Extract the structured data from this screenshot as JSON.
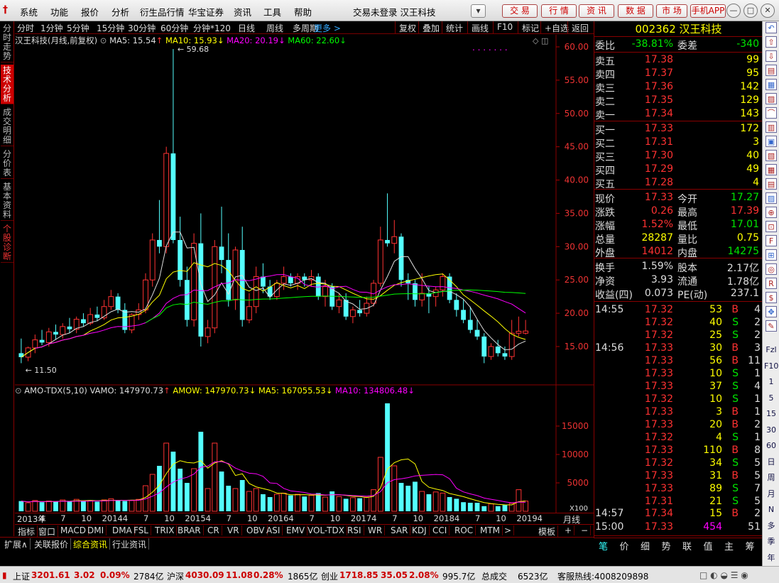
{
  "menubar": {
    "logo": "†",
    "items": [
      "系统",
      "功能",
      "报价",
      "分析",
      "衍生品行情",
      "华宝证券",
      "资讯",
      "工具",
      "帮助"
    ],
    "title": "交易未登录  汉王科技",
    "buttons": [
      "交 易",
      "行 情",
      "资 讯",
      "数 据",
      "市 场",
      "手机APP"
    ]
  },
  "lefttabs": [
    {
      "label": "分时走势"
    },
    {
      "label": "技术分析",
      "active": true
    },
    {
      "label": "成交明细"
    },
    {
      "label": "分价表"
    },
    {
      "label": "基本资料"
    },
    {
      "label": "个股诊断",
      "red": true
    }
  ],
  "toolbar": {
    "periods": [
      "分时",
      "1分钟",
      "5分钟",
      "15分钟",
      "30分钟",
      "60分钟",
      "分钟*120",
      "日线",
      "周线",
      "多周期"
    ],
    "more": "更多 >",
    "right": [
      "复权",
      "叠加",
      "统计",
      "画线",
      "F10",
      "标记",
      "+自选",
      "返回"
    ]
  },
  "chartinfo": {
    "title": "汉王科技(月线,前复权)",
    "ma5": "MA5: 15.54",
    "ma10": "MA10: 15.93",
    "ma20": "MA20: 20.19",
    "ma60": "MA60: 22.60",
    "high_label": "59.68",
    "low_label": "11.50"
  },
  "volinfo": {
    "name": "AMO-TDX(5,10)",
    "vamo": "VAMO: 147970.73",
    "amow": "AMOW: 147970.73",
    "ma5": "MA5: 167055.53",
    "ma10": "MA10: 134806.48",
    "unit": "X100"
  },
  "price_axis": [
    "60.00",
    "55.00",
    "50.00",
    "45.00",
    "40.00",
    "35.00",
    "30.00",
    "25.00",
    "20.00",
    "15.00"
  ],
  "vol_axis": [
    "15000",
    "10000",
    "5000"
  ],
  "xaxis": {
    "labels": [
      "2013年",
      "4",
      "7",
      "10",
      "2014",
      "4",
      "7",
      "10",
      "2015",
      "4",
      "7",
      "10",
      "2016",
      "4",
      "7",
      "10",
      "2017",
      "4",
      "7",
      "10",
      "2018",
      "4",
      "7",
      "10",
      "2019",
      "4"
    ],
    "period": "月线"
  },
  "bottomtabs": [
    "指标",
    "窗口",
    "MACD",
    "DMI",
    "DMA",
    "FSL",
    "TRIX",
    "BRAR",
    "CR",
    "VR",
    "OBV",
    "ASI",
    "EMV",
    "VOL-TDX",
    "RSI",
    "WR",
    "SAR",
    "KDJ",
    "CCI",
    "ROC",
    "MTM",
    ">"
  ],
  "bottom_right": [
    "模板",
    "+",
    "−"
  ],
  "subbar": [
    "扩展∧",
    "关联报价",
    "综合资讯",
    "行业资讯"
  ],
  "quote": {
    "code": "002362 汉王科技",
    "weibi_label": "委比",
    "weibi": "-38.81%",
    "weicha_label": "委差",
    "weicha": "-340",
    "asks": [
      {
        "label": "卖五",
        "price": "17.38",
        "vol": "99"
      },
      {
        "label": "卖四",
        "price": "17.37",
        "vol": "95"
      },
      {
        "label": "卖三",
        "price": "17.36",
        "vol": "142"
      },
      {
        "label": "卖二",
        "price": "17.35",
        "vol": "129"
      },
      {
        "label": "卖一",
        "price": "17.34",
        "vol": "143"
      }
    ],
    "bids": [
      {
        "label": "买一",
        "price": "17.33",
        "vol": "172"
      },
      {
        "label": "买二",
        "price": "17.31",
        "vol": "3"
      },
      {
        "label": "买三",
        "price": "17.30",
        "vol": "40"
      },
      {
        "label": "买四",
        "price": "17.29",
        "vol": "49"
      },
      {
        "label": "买五",
        "price": "17.28",
        "vol": "4"
      }
    ],
    "stats": [
      {
        "l1": "现价",
        "v1": "17.33",
        "c1": "up",
        "l2": "今开",
        "v2": "17.27",
        "c2": "dn"
      },
      {
        "l1": "涨跌",
        "v1": "0.26",
        "c1": "up",
        "l2": "最高",
        "v2": "17.39",
        "c2": "up"
      },
      {
        "l1": "涨幅",
        "v1": "1.52%",
        "c1": "up",
        "l2": "最低",
        "v2": "17.01",
        "c2": "dn"
      },
      {
        "l1": "总量",
        "v1": "28287",
        "c1": "yl",
        "l2": "量比",
        "v2": "0.75",
        "c2": "yl"
      },
      {
        "l1": "外盘",
        "v1": "14012",
        "c1": "up",
        "l2": "内盘",
        "v2": "14275",
        "c2": "dn"
      }
    ],
    "stats2": [
      {
        "l1": "换手",
        "v1": "1.59%",
        "l2": "股本",
        "v2": "2.17亿"
      },
      {
        "l1": "净资",
        "v1": "3.93",
        "l2": "流通",
        "v2": "1.78亿"
      },
      {
        "l1": "收益(四)",
        "v1": "0.073",
        "l2": "PE(动)",
        "v2": "237.1"
      }
    ],
    "ticks": [
      {
        "t": "14:55",
        "p": "17.32",
        "v": "53",
        "s": "B",
        "n": "4"
      },
      {
        "t": "",
        "p": "17.32",
        "v": "40",
        "s": "S",
        "n": "2"
      },
      {
        "t": "",
        "p": "17.32",
        "v": "25",
        "s": "S",
        "n": "2"
      },
      {
        "t": "14:56",
        "p": "17.33",
        "v": "30",
        "s": "B",
        "n": "3"
      },
      {
        "t": "",
        "p": "17.33",
        "v": "56",
        "s": "B",
        "n": "11"
      },
      {
        "t": "",
        "p": "17.33",
        "v": "10",
        "s": "S",
        "n": "1"
      },
      {
        "t": "",
        "p": "17.33",
        "v": "37",
        "s": "S",
        "n": "4"
      },
      {
        "t": "",
        "p": "17.32",
        "v": "10",
        "s": "S",
        "n": "1"
      },
      {
        "t": "",
        "p": "17.33",
        "v": "3",
        "s": "B",
        "n": "1"
      },
      {
        "t": "",
        "p": "17.33",
        "v": "20",
        "s": "B",
        "n": "2"
      },
      {
        "t": "",
        "p": "17.32",
        "v": "4",
        "s": "S",
        "n": "1"
      },
      {
        "t": "",
        "p": "17.33",
        "v": "110",
        "s": "B",
        "n": "8"
      },
      {
        "t": "",
        "p": "17.32",
        "v": "34",
        "s": "S",
        "n": "5"
      },
      {
        "t": "",
        "p": "17.33",
        "v": "31",
        "s": "B",
        "n": "5"
      },
      {
        "t": "",
        "p": "17.33",
        "v": "89",
        "s": "S",
        "n": "7"
      },
      {
        "t": "",
        "p": "17.31",
        "v": "21",
        "s": "S",
        "n": "5"
      },
      {
        "t": "14:57",
        "p": "17.34",
        "v": "15",
        "s": "B",
        "n": "2"
      },
      {
        "t": "15:00",
        "p": "17.33",
        "v": "454",
        "s": "",
        "n": "51"
      }
    ],
    "bottom_tabs": [
      "笔",
      "价",
      "细",
      "势",
      "联",
      "值",
      "主",
      "筹"
    ]
  },
  "rtool": [
    "Fzl",
    "F10",
    "1",
    "5",
    "15",
    "30",
    "60",
    "日",
    "周",
    "月",
    "N",
    "多",
    "季",
    "年"
  ],
  "statusbar": {
    "sh_label": "上证",
    "sh": "3201.61",
    "sh_chg": "3.02",
    "sh_pct": "0.09%",
    "sh_amt": "2784亿",
    "hs_label": "沪深",
    "hs": "4030.09",
    "hs_chg": "11.08",
    "hs_pct": "0.28%",
    "hs_amt": "1865亿",
    "cy_label": "创业",
    "cy": "1718.85",
    "cy_chg": "35.05",
    "cy_pct": "2.08%",
    "cy_amt": "995.7亿",
    "total_label": "总成交",
    "total": "6523亿",
    "hotline": "客服热线:4008209898"
  },
  "chart_data": {
    "type": "candlestick",
    "title": "汉王科技(月线,前复权)",
    "ylim": [
      10,
      62
    ],
    "candles": [
      [
        14.0,
        16.2,
        12.5,
        13.4
      ],
      [
        13.4,
        15.0,
        12.8,
        14.8
      ],
      [
        14.8,
        16.8,
        14.0,
        16.0
      ],
      [
        16.0,
        17.5,
        15.2,
        15.6
      ],
      [
        15.6,
        17.8,
        15.0,
        17.2
      ],
      [
        17.2,
        18.3,
        16.0,
        16.8
      ],
      [
        16.8,
        18.5,
        16.2,
        18.0
      ],
      [
        18.0,
        19.3,
        17.0,
        17.6
      ],
      [
        17.6,
        19.5,
        17.0,
        19.1
      ],
      [
        19.1,
        20.0,
        18.0,
        18.5
      ],
      [
        18.5,
        20.8,
        18.2,
        19.8
      ],
      [
        19.8,
        21.0,
        18.8,
        19.3
      ],
      [
        19.3,
        22.0,
        19.0,
        21.0
      ],
      [
        21.0,
        23.5,
        20.5,
        22.5
      ],
      [
        22.5,
        23.0,
        20.0,
        20.5
      ],
      [
        20.5,
        21.5,
        17.0,
        17.5
      ],
      [
        17.5,
        20.0,
        17.0,
        19.8
      ],
      [
        19.8,
        21.5,
        19.0,
        20.5
      ],
      [
        20.5,
        26.0,
        20.0,
        25.0
      ],
      [
        25.0,
        32.0,
        24.0,
        31.0
      ],
      [
        31.0,
        37.0,
        29.0,
        30.0
      ],
      [
        30.0,
        45.0,
        29.0,
        44.0
      ],
      [
        44.0,
        59.68,
        30.5,
        31.0
      ],
      [
        31.0,
        34.5,
        24.0,
        25.0
      ],
      [
        25.0,
        27.0,
        18.0,
        19.0
      ],
      [
        19.0,
        32.0,
        18.0,
        30.5
      ],
      [
        30.5,
        35.0,
        15.0,
        16.5
      ],
      [
        16.5,
        19.0,
        15.5,
        17.8
      ],
      [
        17.8,
        31.0,
        17.0,
        30.0
      ],
      [
        30.0,
        36.0,
        26.0,
        28.0
      ],
      [
        28.0,
        32.0,
        21.0,
        22.0
      ],
      [
        22.0,
        30.0,
        20.5,
        29.5
      ],
      [
        29.5,
        33.0,
        18.0,
        19.0
      ],
      [
        19.0,
        23.0,
        18.5,
        21.0
      ],
      [
        21.0,
        27.0,
        20.0,
        25.5
      ],
      [
        25.5,
        27.5,
        23.0,
        24.0
      ],
      [
        24.0,
        25.0,
        22.0,
        22.5
      ],
      [
        22.5,
        25.0,
        22.0,
        24.5
      ],
      [
        24.5,
        27.0,
        23.5,
        25.5
      ],
      [
        25.5,
        26.0,
        24.0,
        24.5
      ],
      [
        24.5,
        26.0,
        23.5,
        25.5
      ],
      [
        25.5,
        26.0,
        24.0,
        25.0
      ],
      [
        25.0,
        26.5,
        24.0,
        25.5
      ],
      [
        25.5,
        26.0,
        22.0,
        22.5
      ],
      [
        22.5,
        25.0,
        21.0,
        24.0
      ],
      [
        24.0,
        24.5,
        20.5,
        21.0
      ],
      [
        21.0,
        23.0,
        20.0,
        22.0
      ],
      [
        22.0,
        23.0,
        19.0,
        19.5
      ],
      [
        19.5,
        21.0,
        18.5,
        20.5
      ],
      [
        20.5,
        22.0,
        19.5,
        20.0
      ],
      [
        20.0,
        22.5,
        19.5,
        21.5
      ],
      [
        21.5,
        25.0,
        21.0,
        24.5
      ],
      [
        24.5,
        33.0,
        24.0,
        31.0
      ],
      [
        31.0,
        38.0,
        30.0,
        30.5
      ],
      [
        30.5,
        34.0,
        29.0,
        31.5
      ],
      [
        31.5,
        32.0,
        24.0,
        25.0
      ],
      [
        25.0,
        26.0,
        22.0,
        24.5
      ],
      [
        24.5,
        25.0,
        21.0,
        22.0
      ],
      [
        22.0,
        26.0,
        21.0,
        23.0
      ],
      [
        23.0,
        24.0,
        20.0,
        22.5
      ],
      [
        22.5,
        24.0,
        21.0,
        23.5
      ],
      [
        23.5,
        26.0,
        22.5,
        25.5
      ],
      [
        25.5,
        26.0,
        21.5,
        22.0
      ],
      [
        22.0,
        23.0,
        19.5,
        20.5
      ],
      [
        20.5,
        22.0,
        18.5,
        19.0
      ],
      [
        19.0,
        21.0,
        17.0,
        17.5
      ],
      [
        17.5,
        19.0,
        16.0,
        16.5
      ],
      [
        16.5,
        17.0,
        12.5,
        13.5
      ],
      [
        13.5,
        15.5,
        13.0,
        15.0
      ],
      [
        15.0,
        16.0,
        13.5,
        14.0
      ],
      [
        14.0,
        15.0,
        13.0,
        13.5
      ],
      [
        13.5,
        19.0,
        13.0,
        17.0
      ],
      [
        17.0,
        19.5,
        16.5,
        17.3
      ],
      [
        17.0,
        19.0,
        16.8,
        17.33
      ]
    ],
    "volume": [
      1800,
      1500,
      1900,
      1600,
      1800,
      1700,
      2000,
      1700,
      2100,
      1800,
      1900,
      1700,
      2000,
      2200,
      1900,
      1800,
      1900,
      2100,
      4500,
      6500,
      8000,
      12000,
      10500,
      7500,
      5000,
      7500,
      14000,
      4000,
      12000,
      7000,
      4500,
      4000,
      5500,
      3500,
      4000,
      3000,
      2500,
      3000,
      3200,
      2800,
      3000,
      2600,
      2800,
      3200,
      2500,
      3500,
      2600,
      2200,
      2400,
      2300,
      2500,
      3800,
      9500,
      19000,
      8000,
      5000,
      4500,
      5200,
      3500,
      3000,
      3400,
      3200,
      2500,
      2200,
      1600,
      1500,
      1500,
      900,
      1300,
      900,
      1100,
      1400,
      3800,
      1800
    ],
    "vol_ylim": [
      0,
      19500
    ]
  }
}
